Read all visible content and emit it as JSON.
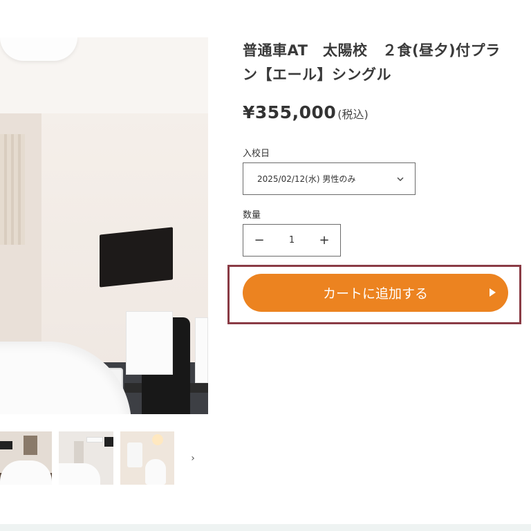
{
  "product": {
    "title_line1": "普通車AT　太陽校　２食(昼夕)付プラ",
    "title_line2": "ン【エール】シングル",
    "price": "¥355,000",
    "price_tax_note": "(税込)"
  },
  "form": {
    "date_label": "入校日",
    "date_selected": "2025/02/12(水) 男性のみ",
    "quantity_label": "数量",
    "quantity_value": "1",
    "decrease_symbol": "−",
    "increase_symbol": "+",
    "add_to_cart_label": "カートに追加する"
  },
  "gallery": {
    "next_symbol": "›"
  },
  "colors": {
    "accent": "#ec8320",
    "highlight_border": "#8a3b45"
  }
}
